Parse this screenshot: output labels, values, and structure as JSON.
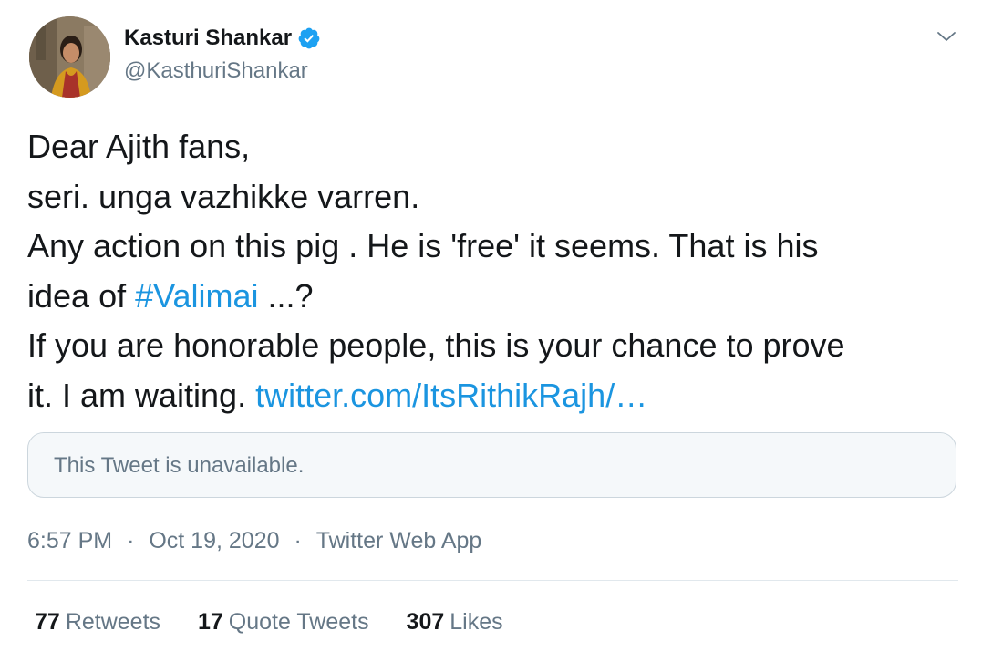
{
  "author": {
    "name": "Kasturi Shankar",
    "handle": "@KasthuriShankar",
    "verified": true,
    "avatar_icon": "profile-photo"
  },
  "tweet": {
    "lines": [
      [
        {
          "text": "Dear Ajith fans,"
        }
      ],
      [
        {
          "text": "seri. unga vazhikke varren."
        }
      ],
      [
        {
          "text": "Any action on this pig . He is 'free' it seems. That is his"
        }
      ],
      [
        {
          "text": "idea of "
        },
        {
          "text": "#Valimai",
          "link": true
        },
        {
          "text": " ...?"
        }
      ],
      [
        {
          "text": "If you are honorable people, this is your chance to prove"
        }
      ],
      [
        {
          "text": "it. I am waiting. "
        },
        {
          "text": "twitter.com/ItsRithikRajh/…",
          "link": true
        }
      ]
    ]
  },
  "quoted": {
    "text": "This Tweet is unavailable."
  },
  "meta": {
    "time": "6:57 PM",
    "separator": "·",
    "date": "Oct 19, 2020",
    "source": "Twitter Web App"
  },
  "stats": [
    {
      "count": "77",
      "label": "Retweets"
    },
    {
      "count": "17",
      "label": "Quote Tweets"
    },
    {
      "count": "307",
      "label": "Likes"
    }
  ],
  "colors": {
    "link": "#1b95e0",
    "secondary_text": "#657786",
    "primary_text": "#14171a",
    "verified_badge": "#1da1f2"
  }
}
